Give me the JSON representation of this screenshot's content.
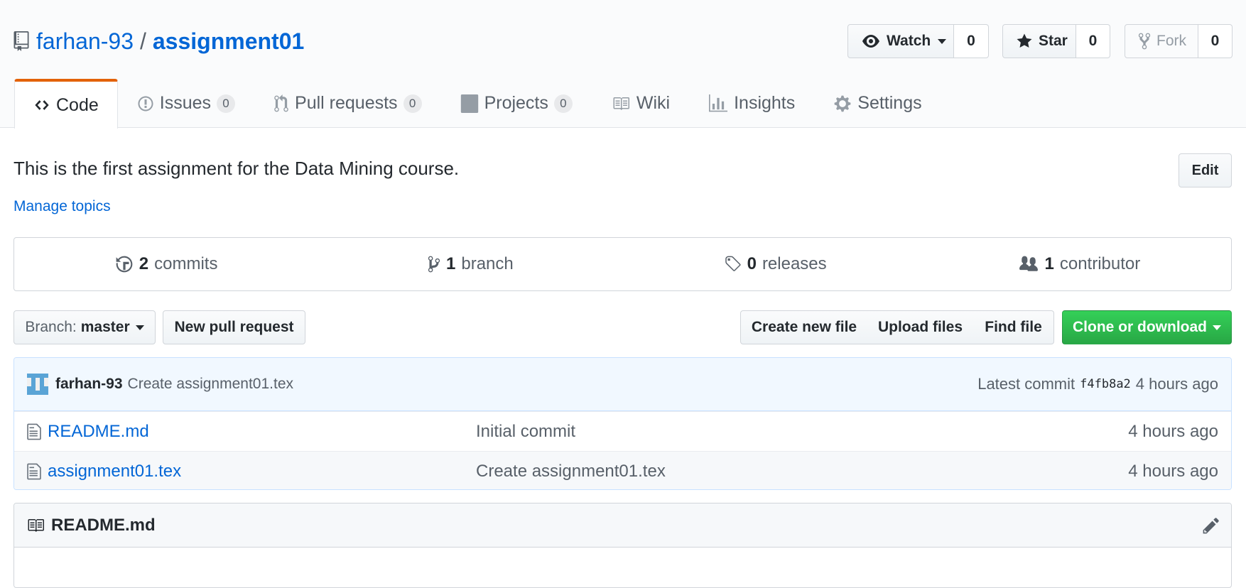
{
  "repo": {
    "owner": "farhan-93",
    "separator": "/",
    "name": "assignment01"
  },
  "actions": {
    "watch_label": "Watch",
    "watch_count": "0",
    "star_label": "Star",
    "star_count": "0",
    "fork_label": "Fork",
    "fork_count": "0"
  },
  "tabs": [
    {
      "label": "Code",
      "icon": "code-icon"
    },
    {
      "label": "Issues",
      "icon": "issue-icon",
      "count": "0"
    },
    {
      "label": "Pull requests",
      "icon": "pull-request-icon",
      "count": "0"
    },
    {
      "label": "Projects",
      "icon": "project-icon",
      "count": "0"
    },
    {
      "label": "Wiki",
      "icon": "book-icon"
    },
    {
      "label": "Insights",
      "icon": "graph-icon"
    },
    {
      "label": "Settings",
      "icon": "gear-icon"
    }
  ],
  "description": "This is the first assignment for the Data Mining course.",
  "manage_topics": "Manage topics",
  "edit_label": "Edit",
  "summary": {
    "commits_num": "2",
    "commits_label": "commits",
    "branch_num": "1",
    "branch_label": "branch",
    "releases_num": "0",
    "releases_label": "releases",
    "contributor_num": "1",
    "contributor_label": "contributor"
  },
  "file_nav": {
    "branch_prefix": "Branch:",
    "branch_name": "master",
    "new_pr": "New pull request",
    "create_file": "Create new file",
    "upload_files": "Upload files",
    "find_file": "Find file",
    "clone": "Clone or download"
  },
  "latest_commit": {
    "author": "farhan-93",
    "message": "Create assignment01.tex",
    "label": "Latest commit",
    "sha": "f4fb8a2",
    "age": "4 hours ago"
  },
  "files": [
    {
      "name": "README.md",
      "message": "Initial commit",
      "age": "4 hours ago"
    },
    {
      "name": "assignment01.tex",
      "message": "Create assignment01.tex",
      "age": "4 hours ago"
    }
  ],
  "readme": {
    "title": "README.md"
  },
  "colors": {
    "link": "#0366d6",
    "tab_accent": "#e36209",
    "clone_green": "#28a745",
    "commit_bg": "#f1f8ff"
  }
}
